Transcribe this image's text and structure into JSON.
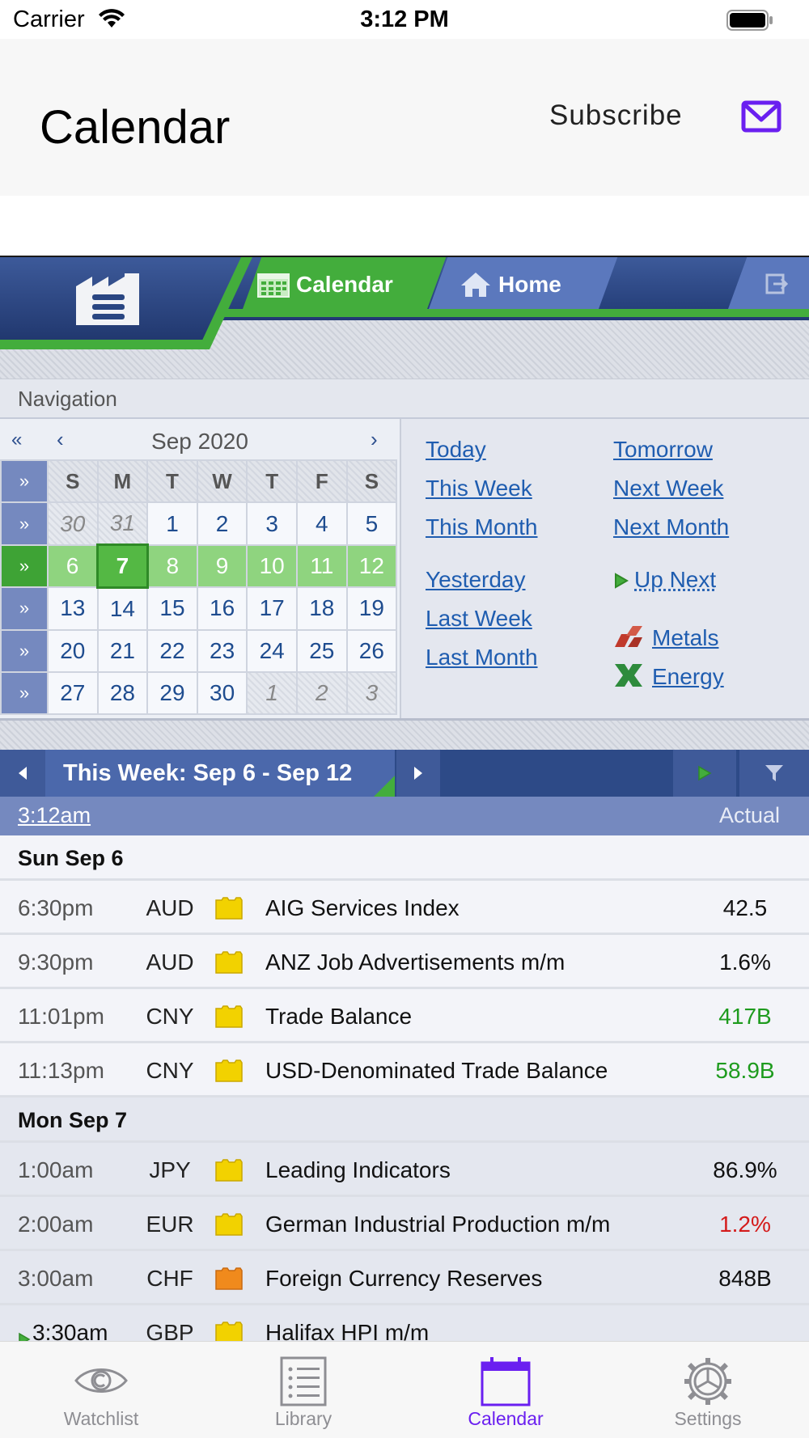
{
  "status_bar": {
    "carrier": "Carrier",
    "time": "3:12 PM"
  },
  "header": {
    "title": "Calendar",
    "subscribe_label": "Subscribe"
  },
  "site_nav": {
    "tab_calendar": "Calendar",
    "tab_home": "Home"
  },
  "navigation_label": "Navigation",
  "mini_calendar": {
    "prev_year": "«",
    "prev_month": "‹",
    "month_label": "Sep 2020",
    "next_month": "›",
    "weekdays": [
      "S",
      "M",
      "T",
      "W",
      "T",
      "F",
      "S"
    ],
    "weeks": [
      [
        "30",
        "31",
        "1",
        "2",
        "3",
        "4",
        "5"
      ],
      [
        "6",
        "7",
        "8",
        "9",
        "10",
        "11",
        "12"
      ],
      [
        "13",
        "14",
        "15",
        "16",
        "17",
        "18",
        "19"
      ],
      [
        "20",
        "21",
        "22",
        "23",
        "24",
        "25",
        "26"
      ],
      [
        "27",
        "28",
        "29",
        "30",
        "1",
        "2",
        "3"
      ]
    ],
    "current_week_index": 1,
    "today": "7"
  },
  "quick_links": {
    "today": "Today",
    "tomorrow": "Tomorrow",
    "this_week": "This Week",
    "next_week": "Next Week",
    "this_month": "This Month",
    "next_month": "Next Month",
    "yesterday": "Yesterday",
    "up_next": "Up Next",
    "last_week": "Last Week",
    "metals": "Metals",
    "last_month": "Last Month",
    "energy": "Energy"
  },
  "week_bar": {
    "title": "This Week: Sep 6 - Sep 12"
  },
  "columns": {
    "time": "3:12am",
    "actual": "Actual"
  },
  "days": [
    {
      "label": "Sun Sep 6",
      "events": [
        {
          "time": "6:30pm",
          "currency": "AUD",
          "impact": "low",
          "name": "AIG Services Index",
          "actual": "42.5",
          "actual_color": "#111111"
        },
        {
          "time": "9:30pm",
          "currency": "AUD",
          "impact": "low",
          "name": "ANZ Job Advertisements m/m",
          "actual": "1.6%",
          "actual_color": "#111111"
        },
        {
          "time": "11:01pm",
          "currency": "CNY",
          "impact": "low",
          "name": "Trade Balance",
          "actual": "417B",
          "actual_color": "#1e9b1e"
        },
        {
          "time": "11:13pm",
          "currency": "CNY",
          "impact": "low",
          "name": "USD-Denominated Trade Balance",
          "actual": "58.9B",
          "actual_color": "#1e9b1e"
        }
      ]
    },
    {
      "label": "Mon Sep 7",
      "events": [
        {
          "time": "1:00am",
          "currency": "JPY",
          "impact": "low",
          "name": "Leading Indicators",
          "actual": "86.9%",
          "actual_color": "#111111"
        },
        {
          "time": "2:00am",
          "currency": "EUR",
          "impact": "low",
          "name": "German Industrial Production m/m",
          "actual": "1.2%",
          "actual_color": "#d41a1a"
        },
        {
          "time": "3:00am",
          "currency": "CHF",
          "impact": "medium",
          "name": "Foreign Currency Reserves",
          "actual": "848B",
          "actual_color": "#111111"
        },
        {
          "time": "3:30am",
          "currency": "GBP",
          "impact": "low",
          "name": "Halifax HPI m/m",
          "actual": "",
          "actual_color": "#111111",
          "up_next": true
        }
      ]
    }
  ],
  "impact_colors": {
    "low": "#f2d200",
    "medium": "#f08a1c"
  },
  "tab_bar": {
    "items": [
      {
        "label": "Watchlist",
        "icon": "eye-icon"
      },
      {
        "label": "Library",
        "icon": "list-icon"
      },
      {
        "label": "Calendar",
        "icon": "calendar-icon",
        "active": true
      },
      {
        "label": "Settings",
        "icon": "gear-icon"
      }
    ]
  }
}
